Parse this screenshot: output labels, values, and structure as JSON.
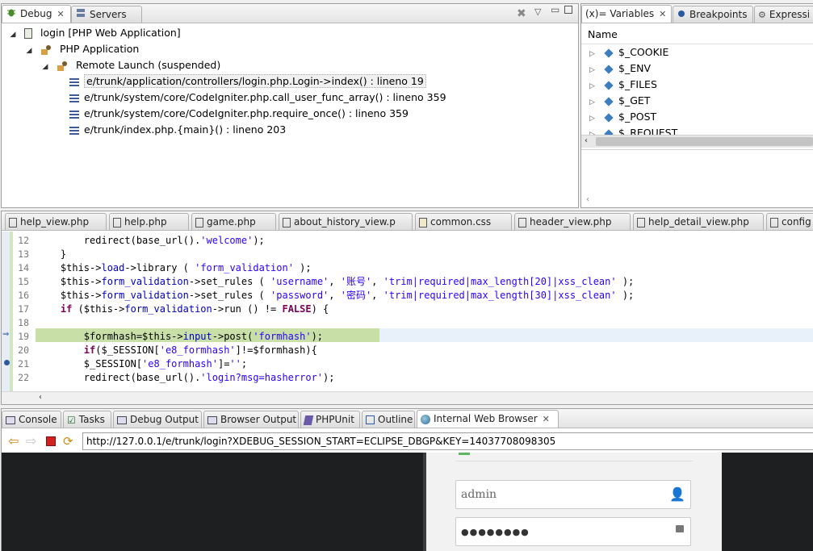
{
  "debug_view": {
    "tabs": [
      {
        "label": "Debug",
        "active": true
      },
      {
        "label": "Servers",
        "active": false
      }
    ],
    "tree": [
      {
        "label": "login [PHP Web Application]",
        "level": 0
      },
      {
        "label": "PHP Application",
        "level": 1
      },
      {
        "label": "Remote Launch (suspended)",
        "level": 2
      },
      {
        "label": "e/trunk/application/controllers/login.php.Login->index() : lineno 19",
        "level": 3,
        "selected": true
      },
      {
        "label": "e/trunk/system/core/CodeIgniter.php.call_user_func_array() : lineno 359",
        "level": 3
      },
      {
        "label": "e/trunk/system/core/CodeIgniter.php.require_once() : lineno 359",
        "level": 3
      },
      {
        "label": "e/trunk/index.php.{main}() : lineno 203",
        "level": 3
      }
    ]
  },
  "variables_view": {
    "tabs": [
      {
        "label": "(x)= Variables",
        "active": true
      },
      {
        "label": "Breakpoints",
        "active": false
      },
      {
        "label": "Expressi",
        "active": false
      }
    ],
    "column_header": "Name",
    "rows": [
      "$_COOKIE",
      "$_ENV",
      "$_FILES",
      "$_GET",
      "$_POST",
      "$_REQUEST"
    ]
  },
  "editor": {
    "tabs": [
      {
        "label": "help_view.php"
      },
      {
        "label": "help.php"
      },
      {
        "label": "game.php"
      },
      {
        "label": "about_history_view.p"
      },
      {
        "label": "common.css"
      },
      {
        "label": "header_view.php"
      },
      {
        "label": "help_detail_view.php"
      },
      {
        "label": "config"
      }
    ],
    "line_numbers": [
      "12",
      "13",
      "14",
      "15",
      "16",
      "17",
      "18",
      "19",
      "20",
      "21",
      "22"
    ],
    "current_line": "19"
  },
  "bottom_panel": {
    "tabs": [
      {
        "label": "Console"
      },
      {
        "label": "Tasks"
      },
      {
        "label": "Debug Output"
      },
      {
        "label": "Browser Output"
      },
      {
        "label": "PHPUnit"
      },
      {
        "label": "Outline"
      },
      {
        "label": "Internal Web Browser",
        "active": true
      }
    ],
    "url": "http://127.0.0.1/e/trunk/login?XDEBUG_SESSION_START=ECLIPSE_DBGP&KEY=14037708098305",
    "username_value": "admin",
    "password_mask": "●●●●●●●●"
  },
  "colors": {
    "highlight_line": "#c8e0a8",
    "selection": "#dbe7f5",
    "web_dark": "#1d1f21"
  }
}
